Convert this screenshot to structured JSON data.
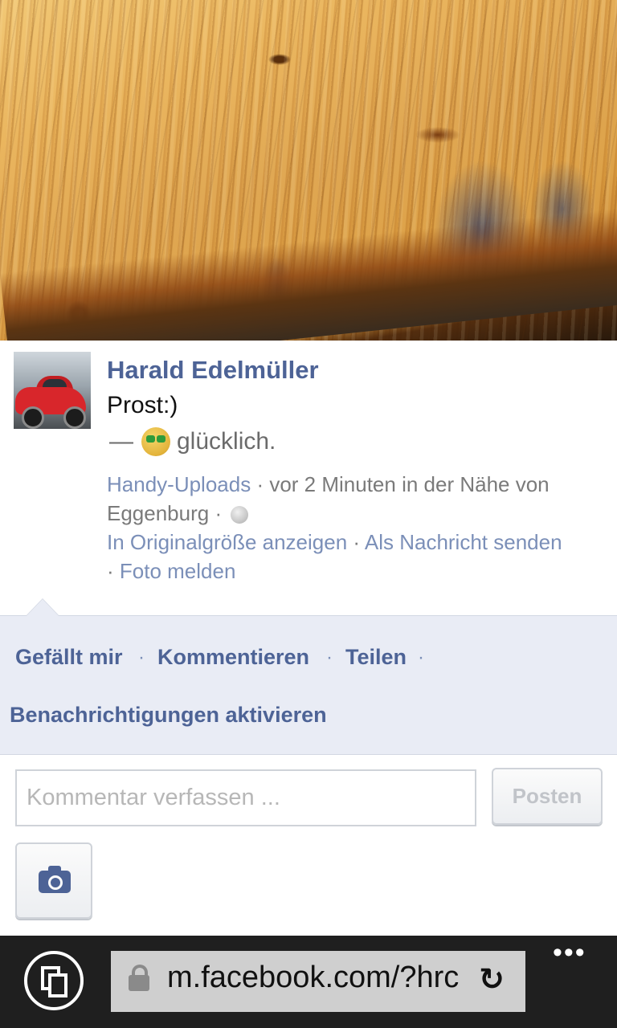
{
  "post": {
    "author": "Harald Edelmüller",
    "caption": "Prost:)",
    "feeling_dash": "—",
    "feeling_text": "glücklich.",
    "album_link": "Handy-Uploads",
    "time_location": " · vor 2 Minuten in der Nähe von Eggenburg · ",
    "view_original": "In Originalgröße anzeigen",
    "dot": " · ",
    "send_message": "Als Nachricht senden",
    "report_prefix": "· ",
    "report_photo": "Foto melden"
  },
  "actions": {
    "like": "Gefällt mir",
    "comment": "Kommentieren",
    "share": "Teilen",
    "notifications": "Benachrichtigungen aktivieren",
    "separator": "·"
  },
  "comment_box": {
    "placeholder": "Kommentar verfassen ...",
    "post_button": "Posten"
  },
  "browser": {
    "url": "m.facebook.com/?hrc",
    "refresh_glyph": "↻",
    "more_glyph": "•••"
  },
  "icons": {
    "emoji": "happy-face-icon",
    "privacy": "globe-icon",
    "camera": "camera-icon",
    "tabs": "tabs-icon",
    "lock": "lock-icon"
  }
}
